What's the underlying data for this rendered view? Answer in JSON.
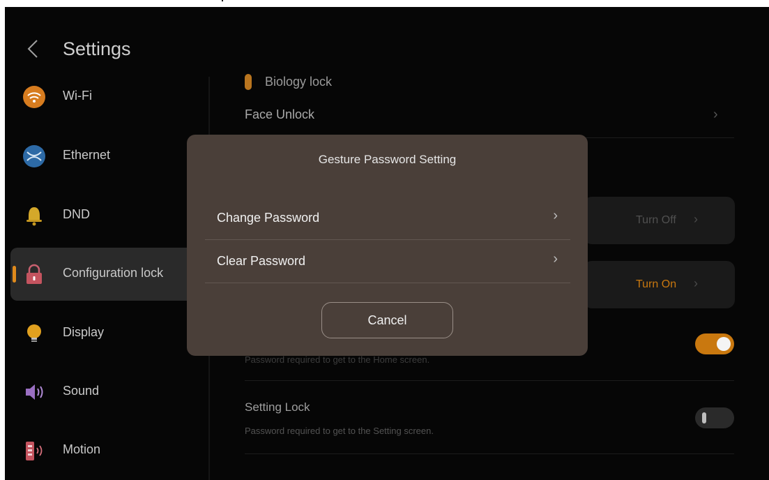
{
  "header": {
    "title": "Settings"
  },
  "sidebar": {
    "items": [
      {
        "label": "Wi-Fi",
        "icon": "wifi-icon"
      },
      {
        "label": "Ethernet",
        "icon": "ethernet-icon"
      },
      {
        "label": "DND",
        "icon": "bell-icon"
      },
      {
        "label": "Configuration lock",
        "icon": "lock-icon",
        "active": true
      },
      {
        "label": "Display",
        "icon": "bulb-icon"
      },
      {
        "label": "Sound",
        "icon": "speaker-icon"
      },
      {
        "label": "Motion",
        "icon": "motion-icon"
      }
    ]
  },
  "content": {
    "biology_lock": "Biology lock",
    "face_unlock": "Face Unlock",
    "turn_off": "Turn Off",
    "turn_on": "Turn On",
    "home_hint": "Password required to get to the Home screen.",
    "setting_lock": "Setting Lock",
    "setting_lock_hint": "Password required to get to the Setting screen.",
    "home_lock_toggle_on": true,
    "setting_lock_toggle_on": false
  },
  "dialog": {
    "title": "Gesture Password Setting",
    "options": [
      "Change Password",
      "Clear Password"
    ],
    "cancel": "Cancel"
  },
  "colors": {
    "accent": "#e08a1c",
    "turn_on": "#c9780f",
    "turn_off": "#505050",
    "dialog_bg": "#4a3f39",
    "background": "#060606"
  }
}
